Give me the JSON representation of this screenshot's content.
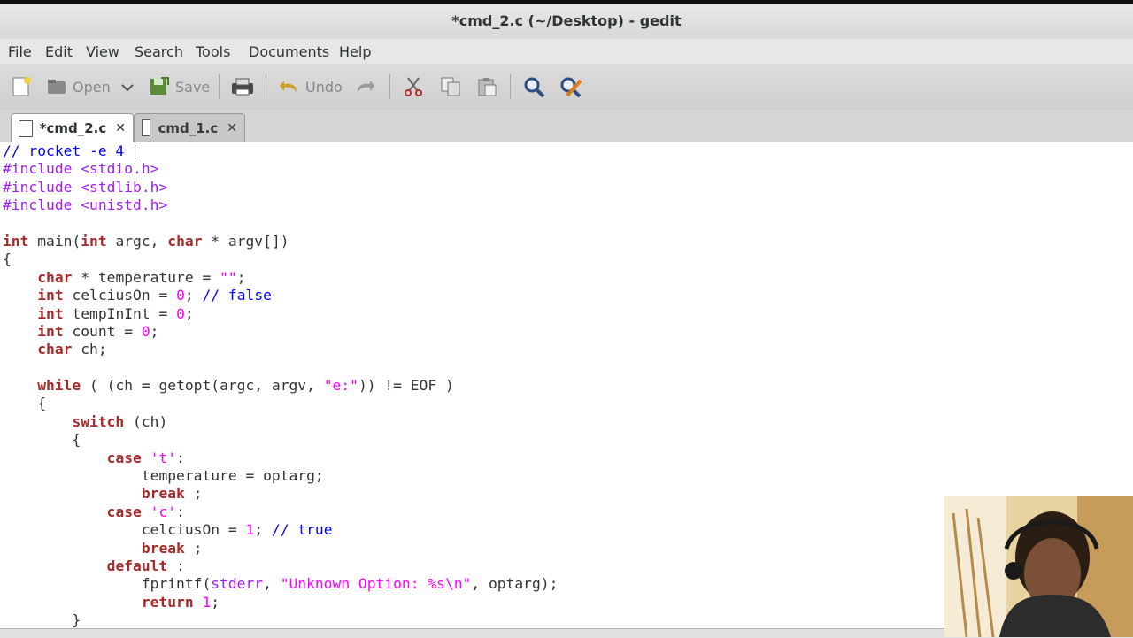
{
  "window": {
    "title": "*cmd_2.c (~/Desktop) - gedit"
  },
  "menu": [
    "File",
    "Edit",
    "View",
    "Search",
    "Tools",
    "Documents",
    "Help"
  ],
  "toolbar": {
    "new_icon": "new-document-icon",
    "open_label": "Open",
    "save_label": "Save",
    "undo_label": "Undo"
  },
  "tabs": [
    {
      "label": "*cmd_2.c",
      "active": true
    },
    {
      "label": "cmd_1.c",
      "active": false
    }
  ],
  "editor": {
    "lines": [
      [
        [
          "cm",
          "// rocket -e 4 "
        ]
      ],
      [
        [
          "pp",
          "#include <stdio.h>"
        ]
      ],
      [
        [
          "pp",
          "#include <stdlib.h>"
        ]
      ],
      [
        [
          "pp",
          "#include <unistd.h>"
        ]
      ],
      [],
      [
        [
          "kw",
          "int"
        ],
        [
          "",
          "main("
        ],
        [
          "kw",
          "int"
        ],
        [
          "",
          "argc, "
        ],
        [
          "kw",
          "char"
        ],
        [
          "",
          "* argv[])"
        ]
      ],
      [
        [
          "",
          "{"
        ]
      ],
      [
        [
          "",
          "    "
        ],
        [
          "kw",
          "char"
        ],
        [
          "",
          "* temperature = "
        ],
        [
          "str",
          "\"\""
        ],
        [
          "",
          ";"
        ]
      ],
      [
        [
          "",
          "    "
        ],
        [
          "kw",
          "int"
        ],
        [
          "",
          "celciusOn = "
        ],
        [
          "num",
          "0"
        ],
        [
          "",
          "; "
        ],
        [
          "cm",
          "// false"
        ]
      ],
      [
        [
          "",
          "    "
        ],
        [
          "kw",
          "int"
        ],
        [
          "",
          "tempInInt = "
        ],
        [
          "num",
          "0"
        ],
        [
          "",
          ";"
        ]
      ],
      [
        [
          "",
          "    "
        ],
        [
          "kw",
          "int"
        ],
        [
          "",
          "count = "
        ],
        [
          "num",
          "0"
        ],
        [
          "",
          ";"
        ]
      ],
      [
        [
          "",
          "    "
        ],
        [
          "kw",
          "char"
        ],
        [
          "",
          "ch;"
        ]
      ],
      [],
      [
        [
          "",
          "    "
        ],
        [
          "kw",
          "while"
        ],
        [
          "",
          "( (ch = getopt(argc, argv, "
        ],
        [
          "str",
          "\"e:\""
        ],
        [
          "",
          ")) != EOF )"
        ]
      ],
      [
        [
          "",
          "    {"
        ]
      ],
      [
        [
          "",
          "        "
        ],
        [
          "kw",
          "switch"
        ],
        [
          "",
          "(ch)"
        ]
      ],
      [
        [
          "",
          "        {"
        ]
      ],
      [
        [
          "",
          "            "
        ],
        [
          "kw",
          "case"
        ],
        [
          "",
          ""
        ],
        [
          "str",
          "'t'"
        ],
        [
          "",
          ":"
        ]
      ],
      [
        [
          "",
          "                temperature = optarg;"
        ]
      ],
      [
        [
          "",
          "                "
        ],
        [
          "kw",
          "break"
        ],
        [
          "",
          ";"
        ]
      ],
      [
        [
          "",
          "            "
        ],
        [
          "kw",
          "case"
        ],
        [
          "",
          ""
        ],
        [
          "str",
          "'c'"
        ],
        [
          "",
          ":"
        ]
      ],
      [
        [
          "",
          "                celciusOn = "
        ],
        [
          "num",
          "1"
        ],
        [
          "",
          "; "
        ],
        [
          "cm",
          "// true"
        ]
      ],
      [
        [
          "",
          "                "
        ],
        [
          "kw",
          "break"
        ],
        [
          "",
          ";"
        ]
      ],
      [
        [
          "",
          "            "
        ],
        [
          "kw",
          "default"
        ],
        [
          "",
          ":"
        ]
      ],
      [
        [
          "",
          "                fprintf("
        ],
        [
          "kw2",
          "stderr"
        ],
        [
          "",
          ", "
        ],
        [
          "str",
          "\"Unknown Option: %s\\n\""
        ],
        [
          "",
          ", optarg);"
        ]
      ],
      [
        [
          "",
          "                "
        ],
        [
          "kw",
          "return"
        ],
        [
          "",
          ""
        ],
        [
          "num",
          "1"
        ],
        [
          "",
          ";"
        ]
      ],
      [
        [
          "",
          "        }"
        ]
      ]
    ]
  }
}
